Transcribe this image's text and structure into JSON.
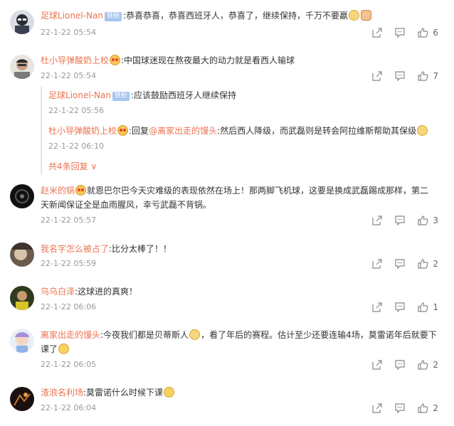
{
  "comments": [
    {
      "user": "足球Lionel-Nan",
      "badge": "铁粉",
      "text": ":恭喜恭喜，恭喜西班牙人，恭喜了，继续保持，千万不要嬴",
      "time": "22-1-22 05:54",
      "likes": "6"
    },
    {
      "user": "杜小导弹酸奶上校",
      "text": ":中国球迷现在熬夜最大的动力就是看西人输球",
      "time": "22-1-22 05:54",
      "likes": "7",
      "replies": [
        {
          "user": "足球Lionel-Nan",
          "badge": "铁粉",
          "text": ":应该鼓励西班牙人继续保持",
          "time": "22-1-22 05:56"
        },
        {
          "user": "杜小导弹酸奶上校",
          "prefix": ":回复",
          "mention": "@离家出走的馒头",
          "text": ":然后西人降级，而武磊则是转会阿拉维斯帮助其保级",
          "time": "22-1-22 06:10"
        }
      ],
      "more_replies": "共4条回复"
    },
    {
      "user": "赵米的锅",
      "text_line1": "就恩巴尔巴今天灾难级的表现依然在场上！那两脚飞机球，这要是换成武磊踢成那样，第二",
      "text_line2": "天新闻保证全是血雨腥风，幸亏武磊不背锅。",
      "time": "22-1-22 05:57",
      "likes": "3"
    },
    {
      "user": "我名字怎么被占了",
      "text": ":比分太棒了！！",
      "time": "22-1-22 05:59",
      "likes": "2"
    },
    {
      "user": "乌乌白泽",
      "text": ":这球进的真爽！",
      "time": "22-1-22 06:06",
      "likes": "1"
    },
    {
      "user": "离家出走的馒头",
      "text_line1a": ":今夜我们都是贝蒂斯人",
      "text_line1b": "，看了年后的赛程。估计至少还要连输4场，莫雷诺年后就要下",
      "text_line2": "课了",
      "time": "22-1-22 06:05",
      "likes": "2"
    },
    {
      "user": "渣浪名利场",
      "text": ":莫雷诺什么时候下课",
      "time": "22-1-22 06:04",
      "likes": "2"
    }
  ],
  "icons": {
    "share": "share-icon",
    "comment": "comment-icon",
    "like": "thumbs-up-icon"
  },
  "colors": {
    "username": "#eb7350",
    "badge": "#a5c6f0",
    "time": "#999999"
  }
}
